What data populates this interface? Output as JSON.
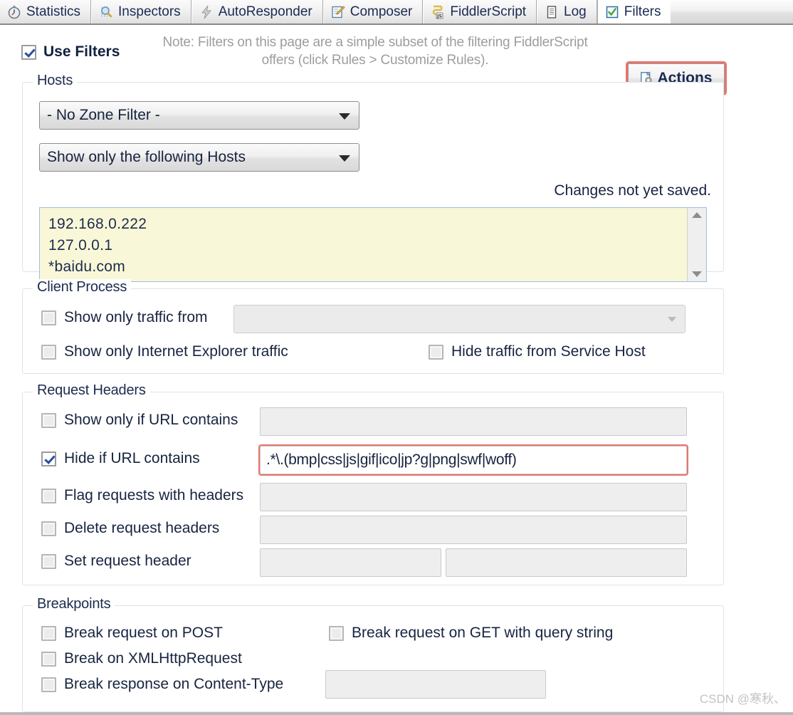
{
  "tabs": [
    {
      "label": "Statistics",
      "icon": "stopwatch-icon",
      "active": false
    },
    {
      "label": "Inspectors",
      "icon": "magnifier-icon",
      "active": false
    },
    {
      "label": "AutoResponder",
      "icon": "lightning-icon",
      "active": false
    },
    {
      "label": "Composer",
      "icon": "notepad-pencil-icon",
      "active": false
    },
    {
      "label": "FiddlerScript",
      "icon": "js-script-icon",
      "active": false
    },
    {
      "label": "Log",
      "icon": "log-document-icon",
      "active": false
    },
    {
      "label": "Filters",
      "icon": "green-check-icon",
      "active": true
    }
  ],
  "toolbar": {
    "use_filters_label": "Use Filters",
    "use_filters_checked": true,
    "note_text": "Note: Filters on this page are a simple subset of the filtering FiddlerScript offers (click Rules > Customize Rules).",
    "actions_label": "Actions",
    "actions_icon": "page-gear-icon"
  },
  "hosts": {
    "legend": "Hosts",
    "zone_filter_value": "- No Zone Filter -",
    "host_filter_value": "Show only the following Hosts",
    "status_text": "Changes not yet saved.",
    "host_list": [
      "192.168.0.222",
      "127.0.0.1",
      "*baidu.com"
    ]
  },
  "client_process": {
    "legend": "Client Process",
    "show_only_traffic_from": {
      "label": "Show only traffic from",
      "checked": false,
      "value": ""
    },
    "show_only_ie_traffic": {
      "label": "Show only Internet Explorer traffic",
      "checked": false
    },
    "hide_service_host": {
      "label": "Hide traffic from Service Host",
      "checked": false
    }
  },
  "request_headers": {
    "legend": "Request Headers",
    "rows": [
      {
        "label": "Show only if URL contains",
        "checked": false,
        "value": ""
      },
      {
        "label": "Hide if URL contains",
        "checked": true,
        "value": ".*\\.(bmp|css|js|gif|ico|jp?g|png|swf|woff)"
      },
      {
        "label": "Flag requests with headers",
        "checked": false,
        "value": ""
      },
      {
        "label": "Delete request headers",
        "checked": false,
        "value": ""
      },
      {
        "label": "Set request header",
        "checked": false,
        "value": "",
        "value2": ""
      }
    ]
  },
  "breakpoints": {
    "legend": "Breakpoints",
    "break_on_post": {
      "label": "Break request on POST",
      "checked": false
    },
    "break_on_get_query": {
      "label": "Break request on GET with query string",
      "checked": false
    },
    "break_on_xhr": {
      "label": "Break on XMLHttpRequest",
      "checked": false
    },
    "break_on_content_type": {
      "label": "Break response on Content-Type",
      "checked": false,
      "value": ""
    }
  },
  "watermark": "CSDN @寒秋、",
  "colors": {
    "accent_red": "#e8756b",
    "text_navy": "#16233f",
    "hosts_bg": "#f8f8d8",
    "note_gray": "#9d9d9d"
  }
}
